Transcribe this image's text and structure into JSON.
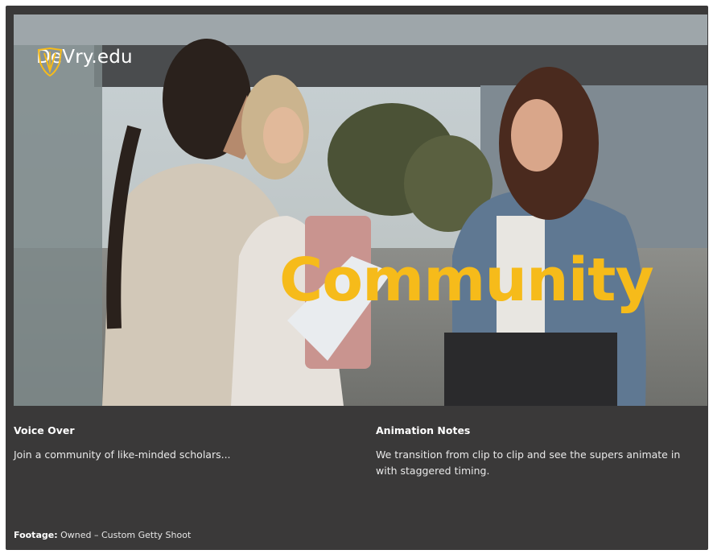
{
  "hero": {
    "brand": "DeVry.edu",
    "super_text": "Community",
    "image_description_icon": "photo-three-students-talking"
  },
  "voice_over": {
    "heading": "Voice Over",
    "text": "Join a community of like-minded scholars..."
  },
  "animation_notes": {
    "heading": "Animation Notes",
    "text": "We transition from clip to clip and see the supers animate in with staggered timing."
  },
  "footage": {
    "label": "Footage:",
    "value": "Owned – Custom Getty Shoot"
  },
  "colors": {
    "background": "#3a3939",
    "accent_yellow": "#f6bb1a",
    "text": "#ffffff"
  }
}
